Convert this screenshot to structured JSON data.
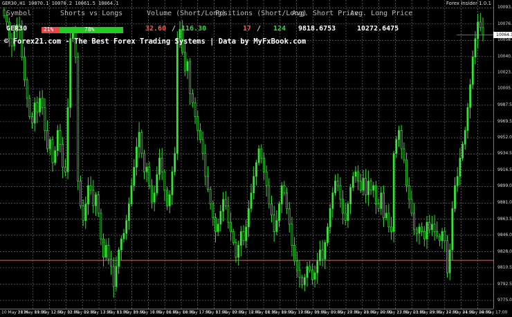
{
  "window": {
    "symbol_info": "GER30,H1  10070.1 10070.2 10061.5 10064.1",
    "indicator_name": "Forex Insider 1.0.1"
  },
  "panel": {
    "headers": {
      "symbol": "Symbol",
      "shorts_vs_longs": "Shorts vs Longs",
      "volume": "Volume (Short/Long)",
      "positions": "Positions (Short/Long)",
      "avg_short": "Avg. Short Price",
      "avg_long": "Avg. Long Price"
    },
    "row": {
      "symbol": "GER30",
      "short_pct": 0.22,
      "short_pct_label": "21%",
      "long_pct_label": "78%",
      "volume_short": "32.60",
      "volume_long": "116.30",
      "separator": "/",
      "positions_short": "17",
      "positions_long": "124",
      "avg_short_price": "9818.6753",
      "avg_long_price": "10272.6475"
    },
    "banner": "© Forex21.com - The Best Forex Trading Systems | Data by MyFxBook.com"
  },
  "colors": {
    "background": "#000000",
    "grid": "#808080",
    "bull_candle": "#33ee33",
    "bear_candle": "#000000",
    "wick": "#33dd33",
    "short_color": "#ee4444",
    "long_color": "#22cc22",
    "short_price_line": "#dd6666"
  },
  "chart_data": {
    "type": "candlestick",
    "symbol": "GER30",
    "timeframe": "H1",
    "ylim": [
      9766,
      10102
    ],
    "price_ticks": [
      "10093.5",
      "10076.0",
      "10058.0",
      "10040.5",
      "10023.0",
      "10005.5",
      "9987.5",
      "9969.5",
      "9952.0",
      "9934.5",
      "9916.5",
      "9899.0",
      "9881.0",
      "9863.5",
      "9846.0",
      "9828.0",
      "9810.5",
      "9792.5",
      "9775.0"
    ],
    "current_price": "10064.1",
    "time_labels": [
      "10 May 2016",
      "11 May 09:00",
      "11 May 17:00",
      "12 May 01:00",
      "12 May 09:00",
      "12 May 17:00",
      "13 May 01:00",
      "13 May 09:00",
      "13 May 17:00",
      "16 May 01:00",
      "16 May 09:00",
      "16 May 17:00",
      "17 May 01:00",
      "17 May 09:00",
      "17 May 17:00",
      "18 May 01:00",
      "18 May 09:00",
      "18 May 17:00",
      "19 May 01:00",
      "19 May 09:00",
      "19 May 17:00",
      "20 May 01:00",
      "20 May 09:00",
      "20 May 17:00",
      "23 May 01:00",
      "23 May 09:00",
      "23 May 17:00",
      "24 May 01:00",
      "24 May 09:00",
      "24 May 17:00"
    ],
    "avg_short_line": 9818.6753,
    "closes": [
      10085,
      10078,
      10060,
      10052,
      10068,
      10075,
      10070,
      10040,
      10015,
      9995,
      9975,
      9968,
      9990,
      9980,
      9995,
      9985,
      9960,
      9940,
      9950,
      9925,
      9938,
      9960,
      9945,
      9920,
      9915,
      9985,
      10060,
      10070,
      10040,
      9905,
      9878,
      9862,
      9880,
      9900,
      9895,
      9878,
      9890,
      9870,
      9842,
      9822,
      9835,
      9820,
      9812,
      9790,
      9812,
      9830,
      9842,
      9848,
      9862,
      9880,
      9900,
      9920,
      9942,
      9958,
      9935,
      9915,
      9920,
      9900,
      9882,
      9892,
      9912,
      9930,
      9915,
      9895,
      9878,
      9890,
      9915,
      9935,
      10060,
      10070,
      10045,
      10025,
      10035,
      10000,
      9990,
      9975,
      9960,
      9950,
      9935,
      9910,
      9896,
      9880,
      9865,
      9850,
      9858,
      9872,
      9885,
      9878,
      9860,
      9850,
      9838,
      9822,
      9835,
      9850,
      9840,
      9855,
      9875,
      9892,
      9910,
      9925,
      9940,
      9930,
      9915,
      9900,
      9880,
      9868,
      9850,
      9862,
      9880,
      9900,
      9892,
      9875,
      9858,
      9835,
      9818,
      9808,
      9800,
      9792,
      9800,
      9812,
      9808,
      9798,
      9805,
      9818,
      9830,
      9820,
      9838,
      9855,
      9875,
      9892,
      9905,
      9900,
      9885,
      9870,
      9862,
      9880,
      9898,
      9910,
      9915,
      9905,
      9895,
      9908,
      9890,
      9905,
      9895,
      9900,
      9880,
      9875,
      9892,
      9865,
      9870,
      9855,
      9850,
      9935,
      9950,
      9960,
      9940,
      9928,
      9900,
      9885,
      9870,
      9852,
      9848,
      9855,
      9850,
      9842,
      9860,
      9852,
      9858,
      9850,
      9845,
      9840,
      9850,
      9840,
      9805,
      9830,
      9875,
      9900,
      9910,
      9930,
      9945,
      9960,
      9985,
      10010,
      10040,
      10060,
      10078,
      10072,
      10064.1
    ]
  }
}
